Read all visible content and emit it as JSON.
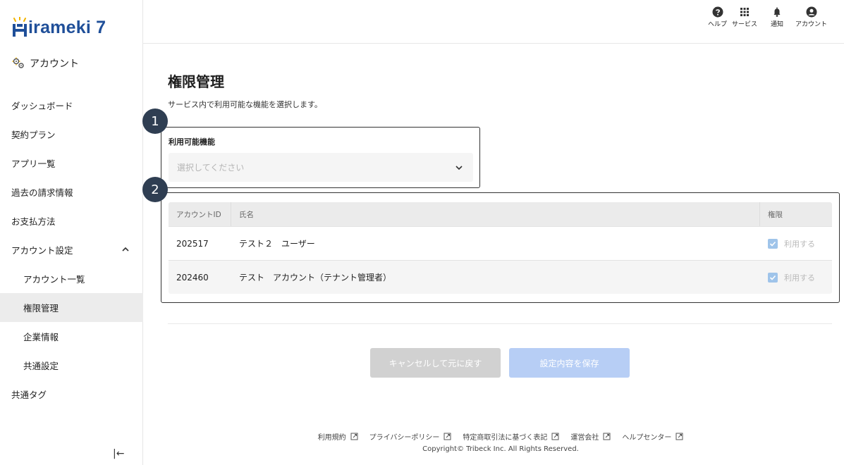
{
  "brand": {
    "logo_text": "irameki 7",
    "logo_mark": "H"
  },
  "sidebar": {
    "section_label": "アカウント",
    "items": [
      {
        "label": "ダッシュボード"
      },
      {
        "label": "契約プラン"
      },
      {
        "label": "アプリ一覧"
      },
      {
        "label": "過去の請求情報"
      },
      {
        "label": "お支払方法"
      },
      {
        "label": "アカウント設定"
      },
      {
        "label": "アカウント一覧"
      },
      {
        "label": "権限管理"
      },
      {
        "label": "企業情報"
      },
      {
        "label": "共通設定"
      },
      {
        "label": "共通タグ"
      }
    ],
    "collapse_glyph": "|←"
  },
  "header": {
    "help": "ヘルプ",
    "services": "サービス",
    "notifications": "通知",
    "account": "アカウント"
  },
  "main": {
    "title": "権限管理",
    "description": "サービス内で利用可能な機能を選択します。",
    "badge1": "1",
    "badge2": "2",
    "feature_label": "利用可能機能",
    "feature_placeholder": "選択してください",
    "table": {
      "headers": {
        "id": "アカウントID",
        "name": "氏名",
        "perm": "権限"
      },
      "rows": [
        {
          "id": "202517",
          "name": "テスト２　ユーザー",
          "perm": "利用する",
          "checked": true
        },
        {
          "id": "202460",
          "name": "テスト　アカウント（テナント管理者）",
          "perm": "利用する",
          "checked": true
        }
      ]
    },
    "cancel_label": "キャンセルして元に戻す",
    "save_label": "設定内容を保存"
  },
  "footer": {
    "links": [
      {
        "label": "利用規約"
      },
      {
        "label": "プライバシーポリシー"
      },
      {
        "label": "特定商取引法に基づく表記"
      },
      {
        "label": "運営会社"
      },
      {
        "label": "ヘルプセンター"
      }
    ],
    "copyright": "Copyright© Tribeck Inc. All Rights Reserved."
  },
  "colors": {
    "brand": "#1f4f99",
    "badge": "#2f3e52",
    "save_button": "#b7cef5",
    "cancel_button": "#d1d1d1",
    "checkbox": "#9fc4ea"
  }
}
